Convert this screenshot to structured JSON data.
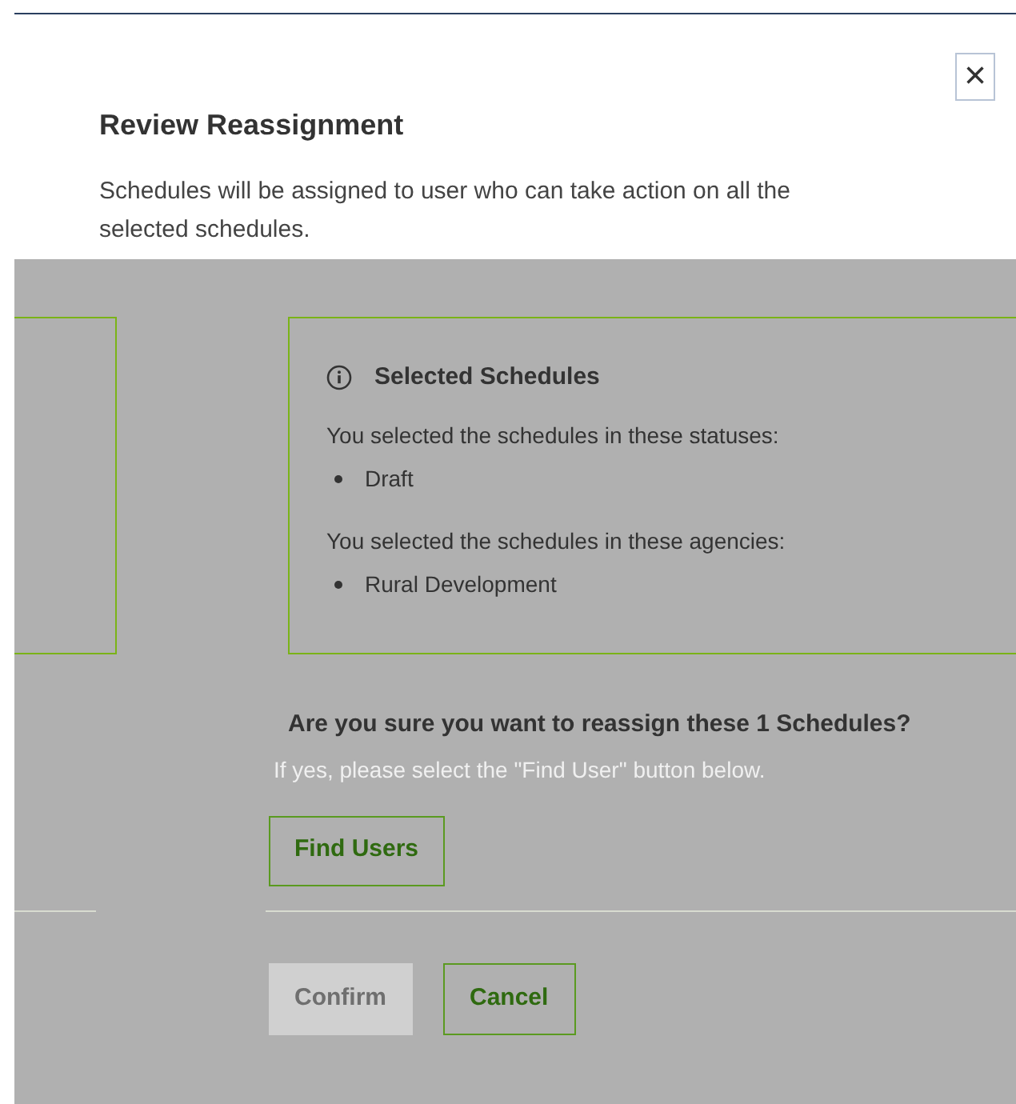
{
  "dialog": {
    "title": "Review Reassignment",
    "description": "Schedules will be assigned to user who can take action on all the selected schedules.",
    "close_label": "×",
    "selected_panel": {
      "title": "Selected Schedules",
      "statuses_label": "You selected the schedules in these statuses:",
      "statuses": [
        "Draft"
      ],
      "agencies_label": "You selected the schedules in these agencies:",
      "agencies": [
        "Rural Development"
      ]
    },
    "question": "Are you sure you want to reassign these 1 Schedules?",
    "hint": "If yes, please select the \"Find User\" button below.",
    "find_button": "Find Users",
    "footer_buttons": [
      {
        "label": "Confirm",
        "kind": "primary",
        "disabled": true
      },
      {
        "label": "Cancel",
        "kind": "secondary",
        "disabled": false
      }
    ]
  }
}
